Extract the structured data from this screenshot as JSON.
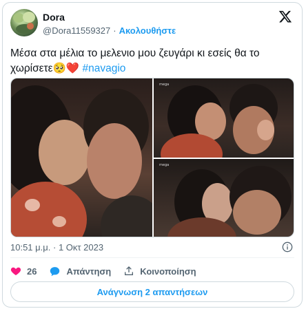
{
  "author": {
    "name": "Dora",
    "handle": "@Dora11559327",
    "separator": "·",
    "follow_label": "Ακολουθήστε"
  },
  "tweet": {
    "text": "Μέσα στα μέλια το μελενιο μου ζευγάρι κι εσείς θα το χωρίσετε",
    "emoji": "🥺❤️",
    "hashtag": "#navagio"
  },
  "media": {
    "watermark": "mega"
  },
  "meta": {
    "time": "10:51 μ.μ.",
    "separator": "·",
    "date": "1 Οκτ 2023"
  },
  "actions": {
    "like_count": "26",
    "reply_label": "Απάντηση",
    "share_label": "Κοινοποίηση"
  },
  "read_replies_label": "Ανάγνωση 2 απαντήσεων",
  "colors": {
    "accent": "#1d9bf0",
    "like": "#f91880",
    "muted": "#536471"
  }
}
